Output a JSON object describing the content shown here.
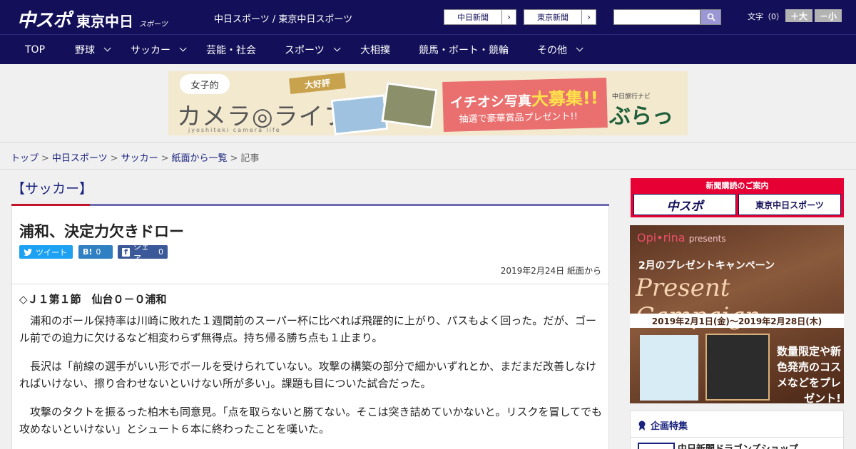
{
  "header": {
    "logo_main": "中スポ",
    "logo_sub": "東京中日",
    "logo_small": "スポーツ",
    "site_title": "中日スポーツ / 東京中日スポーツ",
    "links": [
      {
        "label": "中日新聞"
      },
      {
        "label": "東京新聞"
      }
    ],
    "search_placeholder": "",
    "font_label": "文字（0）",
    "font_increase": "＋大",
    "font_decrease": "－小"
  },
  "nav": {
    "items": [
      {
        "label": "TOP",
        "dropdown": false
      },
      {
        "label": "野球",
        "dropdown": true
      },
      {
        "label": "サッカー",
        "dropdown": true
      },
      {
        "label": "芸能・社会",
        "dropdown": false
      },
      {
        "label": "スポーツ",
        "dropdown": true
      },
      {
        "label": "大相撲",
        "dropdown": false
      },
      {
        "label": "競馬・ボート・競輪",
        "dropdown": false
      },
      {
        "label": "その他",
        "dropdown": true
      }
    ]
  },
  "banner": {
    "bubble": "女子的",
    "title": "カメラ◎ライフ",
    "subtitle": "jyoshiteki camera life",
    "ribbon": "大好評",
    "headline_a": "イチオシ写真",
    "headline_b": "大募集!!",
    "prize": "抽選で豪華賞品プレゼント!!",
    "brand_small": "中日旅行ナビ",
    "brand": "ぶらっ人"
  },
  "breadcrumb": {
    "items": [
      "トップ",
      "中日スポーツ",
      "サッカー",
      "紙面から一覧"
    ],
    "current": "記事"
  },
  "article": {
    "category": "【サッカー】",
    "headline": "浦和、決定力欠きドロー",
    "share": {
      "tweet": "ツイート",
      "hatena_count": "0",
      "facebook": "シェア",
      "facebook_count": "0"
    },
    "date": "2019年2月24日 紙面から",
    "subhead": "◇Ｊ１第１節　仙台０－０浦和",
    "paragraphs": [
      "浦和のボール保持率は川崎に敗れた１週間前のスーパー杯に比べれば飛躍的に上がり、パスもよく回った。だが、ゴール前での迫力に欠けるなど相変わらず無得点。持ち帰る勝ち点も１止まり。",
      "長沢は「前線の選手がいい形でボールを受けられていない。攻撃の構築の部分で細かいずれとか、まだまだ改善しなければいけない、擦り合わせないといけない所が多い」。課題も目についた試合だった。",
      "攻撃のタクトを振るった柏木も同意見。「点を取らないと勝てない。そこは突き詰めていかないと。リスクを冒してでも攻めないといけない」とシュート６本に終わったことを嘆いた。"
    ]
  },
  "sidebar": {
    "subscription_label": "新聞購読のご案内",
    "subscription_left": "中スポ",
    "subscription_right": "東京中日スポーツ",
    "ad": {
      "brand": "Opi•rina",
      "presents": "presents",
      "campaign": "2月のプレゼントキャンペーン",
      "title": "Present Campaign",
      "period": "2019年2月1日(金)～2019年2月28日(木)",
      "promo": "数量限定や新色発売のコスメなどをプレゼント!"
    },
    "feature_title": "企画特集",
    "feature_item": "中日新聞ドラゴンズショップ"
  },
  "colors": {
    "header_bg": "#131059",
    "accent_red": "#c0142b",
    "link": "#1a237e"
  }
}
